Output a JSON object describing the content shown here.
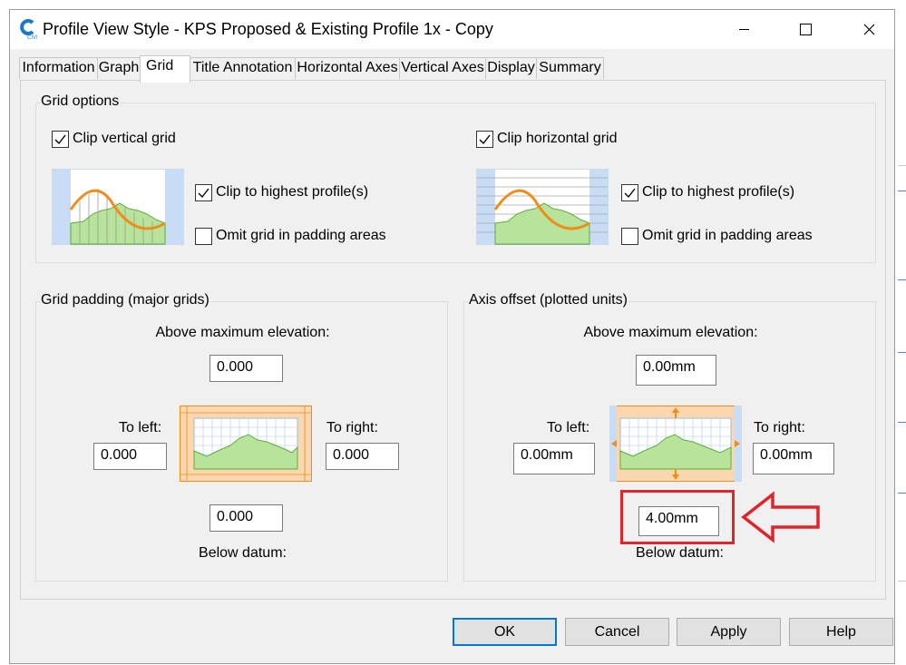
{
  "window": {
    "title": "Profile View Style - KPS Proposed & Existing Profile 1x - Copy",
    "app_icon": "civil3d-app-icon",
    "minimize_icon": "minimize-icon",
    "maximize_icon": "maximize-icon",
    "close_icon": "close-icon"
  },
  "tabs": [
    {
      "label": "Information"
    },
    {
      "label": "Graph"
    },
    {
      "label": "Grid",
      "active": true
    },
    {
      "label": "Title Annotation"
    },
    {
      "label": "Horizontal Axes"
    },
    {
      "label": "Vertical Axes"
    },
    {
      "label": "Display"
    },
    {
      "label": "Summary"
    }
  ],
  "grid_options": {
    "title": "Grid options",
    "clip_vertical": {
      "label": "Clip vertical grid",
      "checked": true
    },
    "clip_horizontal": {
      "label": "Clip horizontal grid",
      "checked": true
    },
    "vertical": {
      "clip_highest": {
        "label": "Clip to highest profile(s)",
        "checked": true
      },
      "omit_padding": {
        "label": "Omit grid in padding areas",
        "checked": false
      }
    },
    "horizontal": {
      "clip_highest": {
        "label": "Clip to highest profile(s)",
        "checked": true
      },
      "omit_padding": {
        "label": "Omit grid in padding areas",
        "checked": false
      }
    }
  },
  "grid_padding": {
    "title": "Grid padding (major grids)",
    "above_label": "Above maximum elevation:",
    "above_value": "0.000",
    "left_label": "To left:",
    "left_value": "0.000",
    "right_label": "To right:",
    "right_value": "0.000",
    "below_value": "0.000",
    "below_label": "Below datum:"
  },
  "axis_offset": {
    "title": "Axis offset (plotted units)",
    "above_label": "Above maximum elevation:",
    "above_value": "0.00mm",
    "left_label": "To left:",
    "left_value": "0.00mm",
    "right_label": "To right:",
    "right_value": "0.00mm",
    "below_value": "4.00mm",
    "below_label": "Below datum:"
  },
  "annotation": {
    "highlight_color": "#e0242b",
    "arrow_icon": "left-arrow-callout-icon"
  },
  "buttons": {
    "ok": "OK",
    "cancel": "Cancel",
    "apply": "Apply",
    "help": "Help"
  },
  "colors": {
    "accent": "#0078d7",
    "profile_orange": "#f08c1a",
    "profile_green": "#6cbf4a",
    "padding_blue": "#c8dcf5"
  }
}
